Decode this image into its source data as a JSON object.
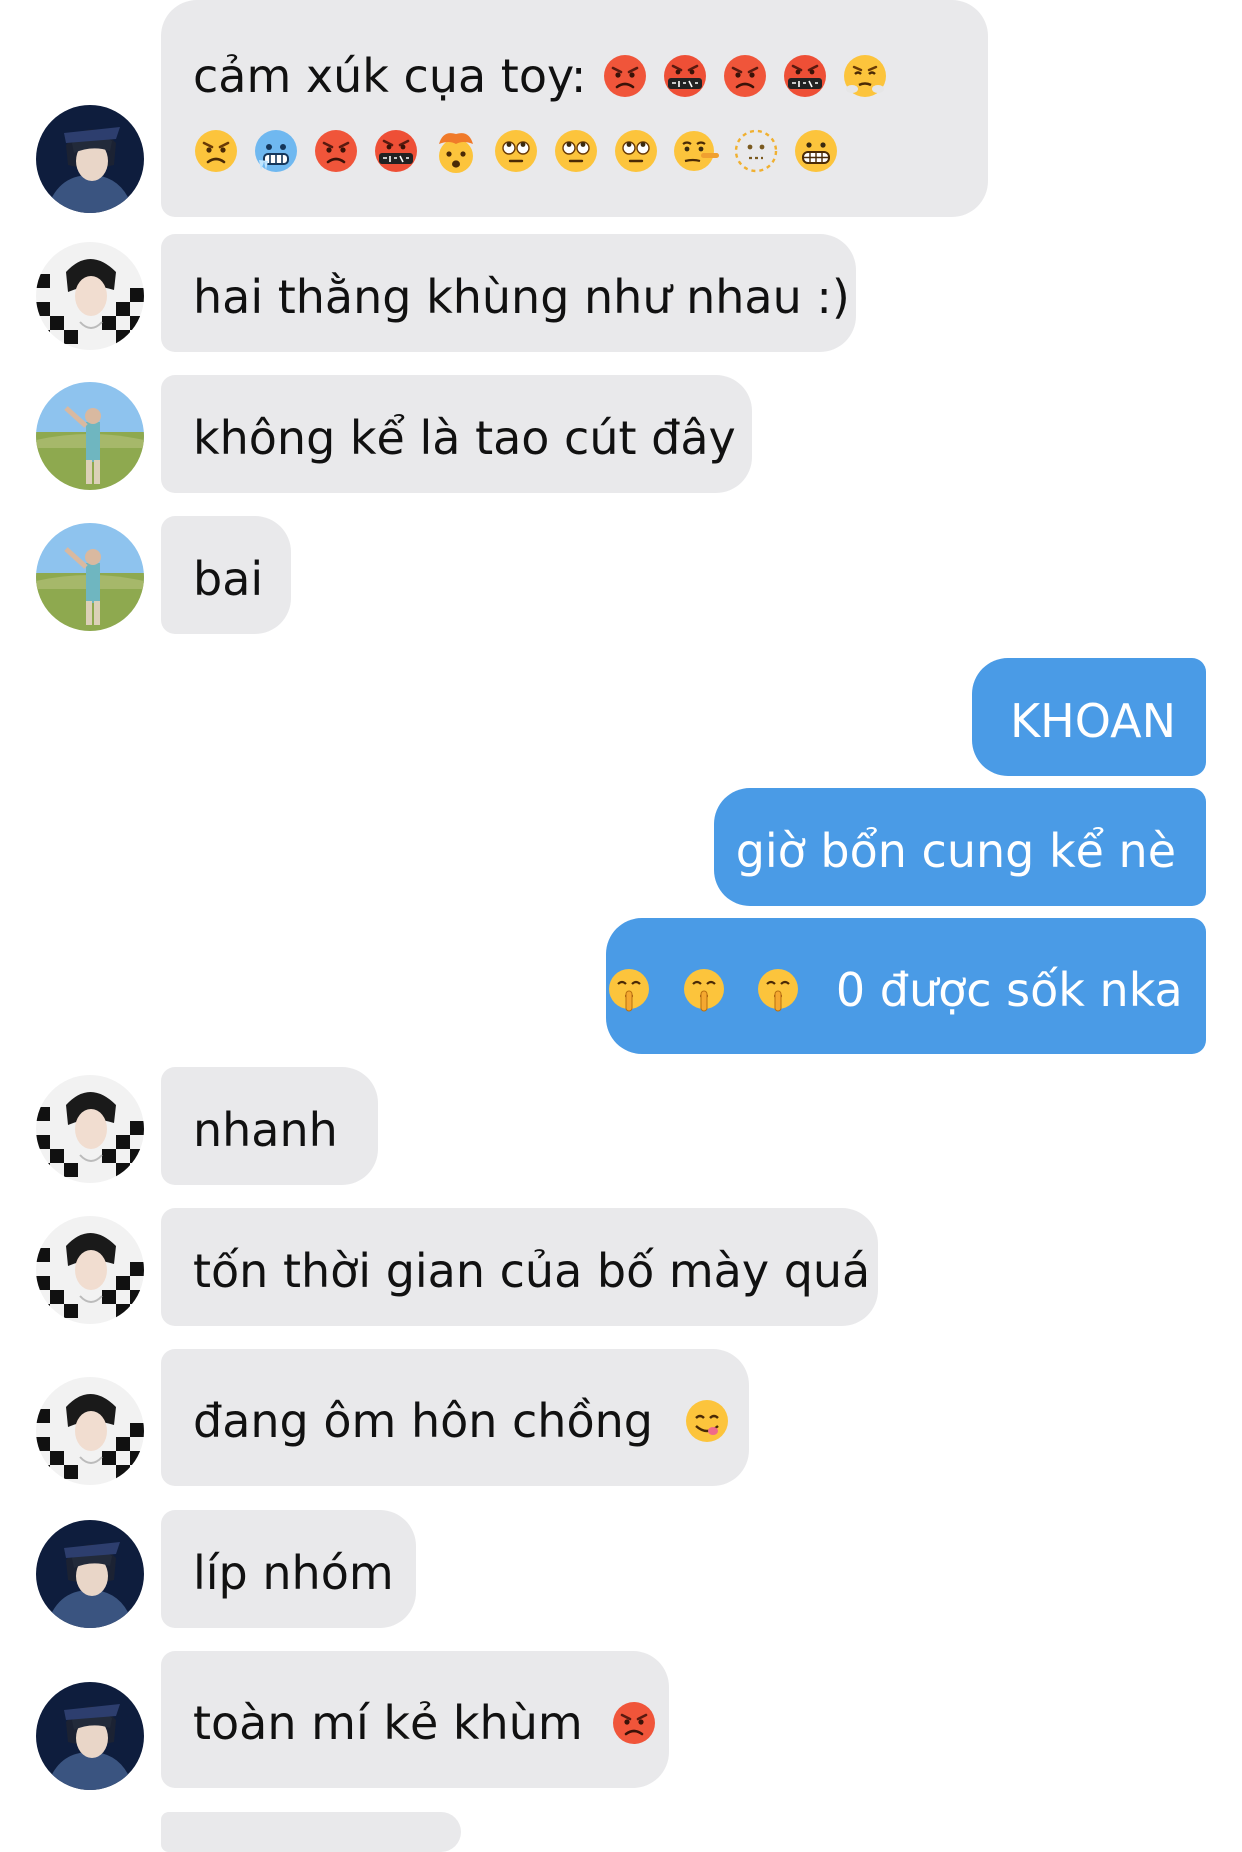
{
  "conversation": {
    "messages": [
      {
        "id": "m1",
        "sender": "friend-blue",
        "direction": "incoming",
        "text": "cảm xúk cụa toy:",
        "emoji_line1": [
          "pouting-face",
          "face-with-symbols-on-mouth",
          "pouting-face",
          "face-with-symbols-on-mouth",
          "face-with-steam-from-nose"
        ],
        "emoji_line2": [
          "angry-face",
          "cold-face",
          "pouting-face",
          "face-with-symbols-on-mouth",
          "exploding-head",
          "face-with-rolling-eyes",
          "face-with-rolling-eyes",
          "face-with-rolling-eyes",
          "lying-face",
          "dotted-line-face",
          "grimacing-face"
        ]
      },
      {
        "id": "m2",
        "sender": "friend-checker",
        "direction": "incoming",
        "text": "hai thằng khùng như nhau :)"
      },
      {
        "id": "m3",
        "sender": "friend-field",
        "direction": "incoming",
        "text": "không kể là tao cút đây"
      },
      {
        "id": "m4",
        "sender": "friend-field",
        "direction": "incoming",
        "text": "bai"
      },
      {
        "id": "m5",
        "sender": "me",
        "direction": "outgoing",
        "text": "KHOAN"
      },
      {
        "id": "m6",
        "sender": "me",
        "direction": "outgoing",
        "text": "giờ bổn cung kể nè"
      },
      {
        "id": "m7",
        "sender": "me",
        "direction": "outgoing",
        "text": "0 được sốk nka",
        "emoji_prefix": [
          "shushing-face",
          "shushing-face",
          "shushing-face"
        ]
      },
      {
        "id": "m8",
        "sender": "friend-checker",
        "direction": "incoming",
        "text": "nhanh"
      },
      {
        "id": "m9",
        "sender": "friend-checker",
        "direction": "incoming",
        "text": "tốn thời gian của bố mày quá"
      },
      {
        "id": "m10",
        "sender": "friend-checker",
        "direction": "incoming",
        "text": "đang ôm hôn chồng",
        "emoji_suffix": [
          "face-savoring-food"
        ]
      },
      {
        "id": "m11",
        "sender": "friend-blue",
        "direction": "incoming",
        "text": "líp nhóm"
      },
      {
        "id": "m12",
        "sender": "friend-blue",
        "direction": "incoming",
        "text": "toàn mí kẻ khùm",
        "emoji_suffix": [
          "pouting-face"
        ]
      }
    ]
  },
  "colors": {
    "incoming_bubble": "#e9e9eb",
    "outgoing_bubble": "#4a9be6",
    "incoming_text": "#111111",
    "outgoing_text": "#ffffff"
  }
}
